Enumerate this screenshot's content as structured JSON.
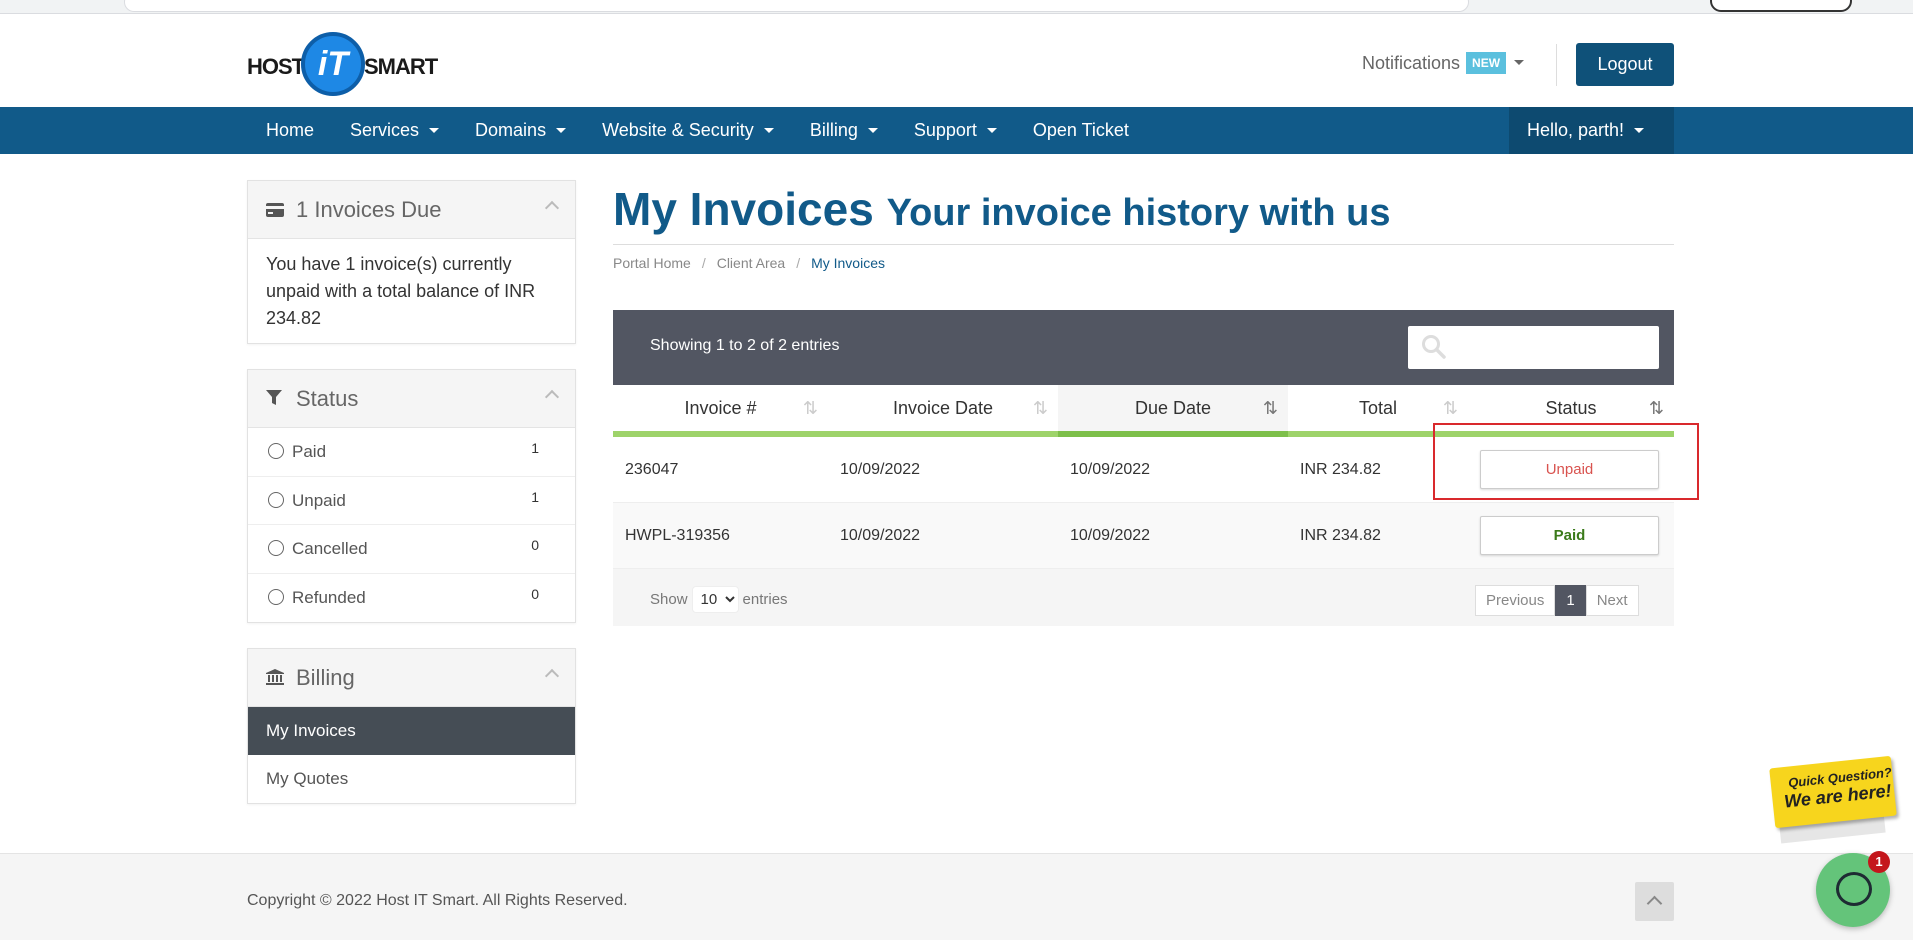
{
  "header": {
    "logo": {
      "left": "HOST",
      "middle": "iT",
      "right": "SMART"
    },
    "notifications_label": "Notifications",
    "notifications_badge": "NEW",
    "logout_label": "Logout"
  },
  "nav": {
    "items": [
      {
        "label": "Home",
        "has_caret": false
      },
      {
        "label": "Services",
        "has_caret": true
      },
      {
        "label": "Domains",
        "has_caret": true
      },
      {
        "label": "Website & Security",
        "has_caret": true
      },
      {
        "label": "Billing",
        "has_caret": true
      },
      {
        "label": "Support",
        "has_caret": true
      },
      {
        "label": "Open Ticket",
        "has_caret": false
      }
    ],
    "user_menu": "Hello, parth!"
  },
  "sidebar": {
    "invoices_due": {
      "title": "1 Invoices Due",
      "text": "You have 1 invoice(s) currently unpaid with a total balance of INR 234.82"
    },
    "status": {
      "title": "Status",
      "items": [
        {
          "label": "Paid",
          "count": "1"
        },
        {
          "label": "Unpaid",
          "count": "1"
        },
        {
          "label": "Cancelled",
          "count": "0"
        },
        {
          "label": "Refunded",
          "count": "0"
        }
      ]
    },
    "billing": {
      "title": "Billing",
      "items": [
        {
          "label": "My Invoices",
          "active": true
        },
        {
          "label": "My Quotes",
          "active": false
        }
      ]
    }
  },
  "main": {
    "title": "My Invoices",
    "subtitle": "Your invoice history with us",
    "breadcrumb": [
      "Portal Home",
      "Client Area",
      "My Invoices"
    ],
    "table": {
      "info": "Showing 1 to 2 of 2 entries",
      "search_placeholder": "",
      "columns": [
        "Invoice #",
        "Invoice Date",
        "Due Date",
        "Total",
        "Status"
      ],
      "rows": [
        {
          "invoice": "236047",
          "invoice_date": "10/09/2022",
          "due_date": "10/09/2022",
          "total": "INR 234.82",
          "status": "Unpaid"
        },
        {
          "invoice": "HWPL-319356",
          "invoice_date": "10/09/2022",
          "due_date": "10/09/2022",
          "total": "INR 234.82",
          "status": "Paid"
        }
      ],
      "show_label": "Show",
      "entries_label": "entries",
      "page_length": "10",
      "pager": {
        "previous": "Previous",
        "current": "1",
        "next": "Next"
      }
    }
  },
  "footer": {
    "copyright": "Copyright © 2022 Host IT Smart. All Rights Reserved."
  },
  "chat": {
    "quick_line1": "Quick Question?",
    "quick_line2": "We are here!",
    "unread": "1"
  },
  "colors": {
    "brand_blue": "#115a89",
    "table_header_dark": "#525662",
    "column_underline": "#9ed36a",
    "unpaid": "#d9534f",
    "paid": "#3a7a1a"
  }
}
